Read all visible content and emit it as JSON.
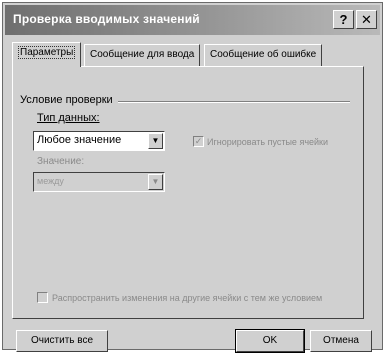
{
  "window": {
    "title": "Проверка вводимых значений",
    "help_glyph": "?",
    "close_glyph": "✕"
  },
  "tabs": [
    {
      "label": "Параметры",
      "active": true
    },
    {
      "label": "Сообщение для ввода",
      "active": false
    },
    {
      "label": "Сообщение об ошибке",
      "active": false
    }
  ],
  "validation": {
    "group_label": "Условие проверки",
    "data_type_label": "Тип данных:",
    "data_type_value": "Любое значение",
    "value_label": "Значение:",
    "value_value": "между",
    "ignore_blank_label": "Игнорировать пустые ячейки",
    "ignore_blank_checked": true,
    "ignore_blank_enabled": false,
    "apply_all_label": "Распространить изменения на другие ячейки с тем же условием",
    "apply_all_checked": false,
    "apply_all_enabled": false
  },
  "buttons": {
    "clear_all": "Очистить все",
    "ok": "OK",
    "cancel": "Отмена"
  },
  "icons": {
    "dropdown": "chevron-down-icon",
    "check": "checkmark-icon"
  }
}
